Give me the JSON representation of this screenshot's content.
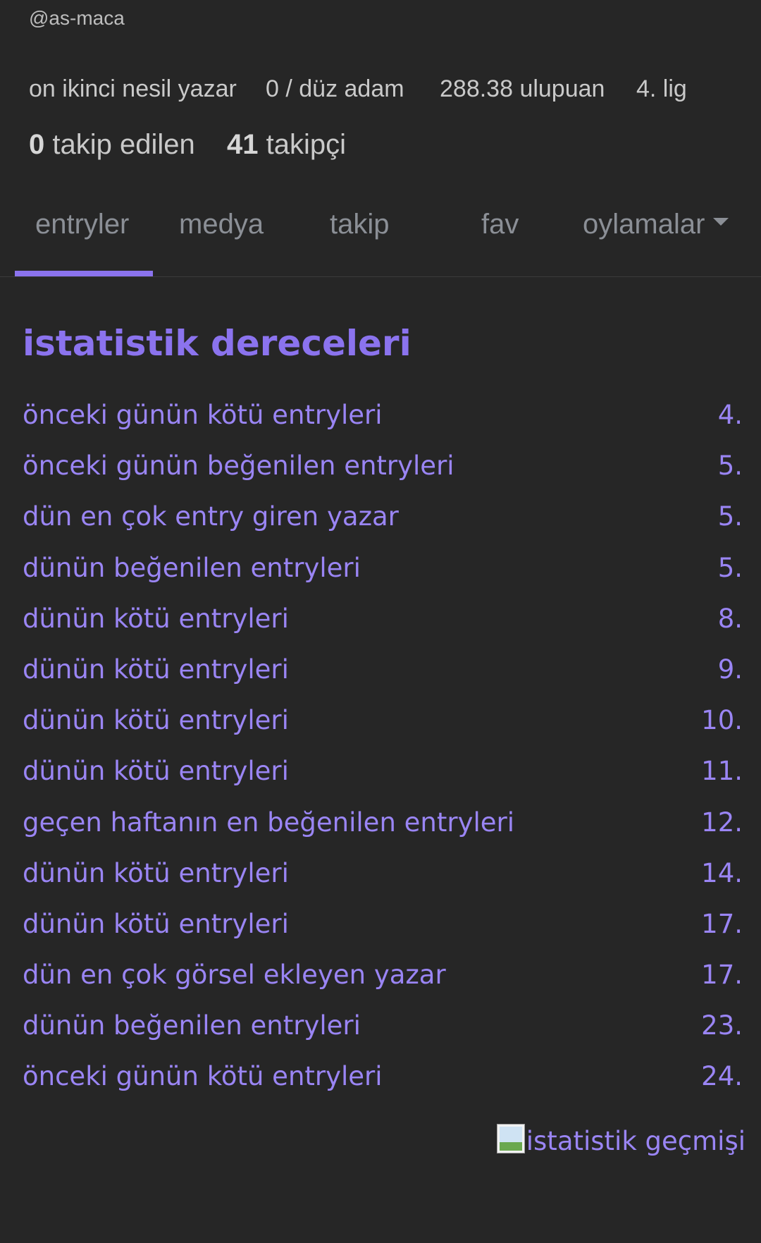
{
  "profile": {
    "handle": "@as-maca",
    "generation": "on ikinci nesil yazar",
    "rank_title": "0 / düz adam",
    "points": "288.38 ulupuan",
    "league": "4. lig",
    "following_count": "0",
    "following_label": " takip edilen",
    "followers_count": "41",
    "followers_label": " takipçi"
  },
  "tabs": [
    {
      "label": "entryler",
      "active": true
    },
    {
      "label": "medya",
      "active": false
    },
    {
      "label": "takip",
      "active": false
    },
    {
      "label": "fav",
      "active": false
    },
    {
      "label": "oylamalar",
      "active": false,
      "dropdown": true
    }
  ],
  "stats": {
    "title": "istatistik dereceleri",
    "items": [
      {
        "label": "önceki günün kötü entryleri",
        "rank": "4."
      },
      {
        "label": "önceki günün beğenilen entryleri",
        "rank": "5."
      },
      {
        "label": "dün en çok entry giren yazar",
        "rank": "5."
      },
      {
        "label": "dünün beğenilen entryleri",
        "rank": "5."
      },
      {
        "label": "dünün kötü entryleri",
        "rank": "8."
      },
      {
        "label": "dünün kötü entryleri",
        "rank": "9."
      },
      {
        "label": "dünün kötü entryleri",
        "rank": "10."
      },
      {
        "label": "dünün kötü entryleri",
        "rank": "11."
      },
      {
        "label": "geçen haftanın en beğenilen entryleri",
        "rank": "12."
      },
      {
        "label": "dünün kötü entryleri",
        "rank": "14."
      },
      {
        "label": "dünün kötü entryleri",
        "rank": "17."
      },
      {
        "label": "dün en çok görsel ekleyen yazar",
        "rank": "17."
      },
      {
        "label": "dünün beğenilen entryleri",
        "rank": "23."
      },
      {
        "label": "önceki günün kötü entryleri",
        "rank": "24."
      }
    ],
    "history_link": "istatistik geçmişi"
  },
  "colors": {
    "background": "#262626",
    "accent": "#8b73ee",
    "link": "#9a85f4",
    "muted_text": "#c9c9c9",
    "tab_text": "#8b8f96"
  }
}
